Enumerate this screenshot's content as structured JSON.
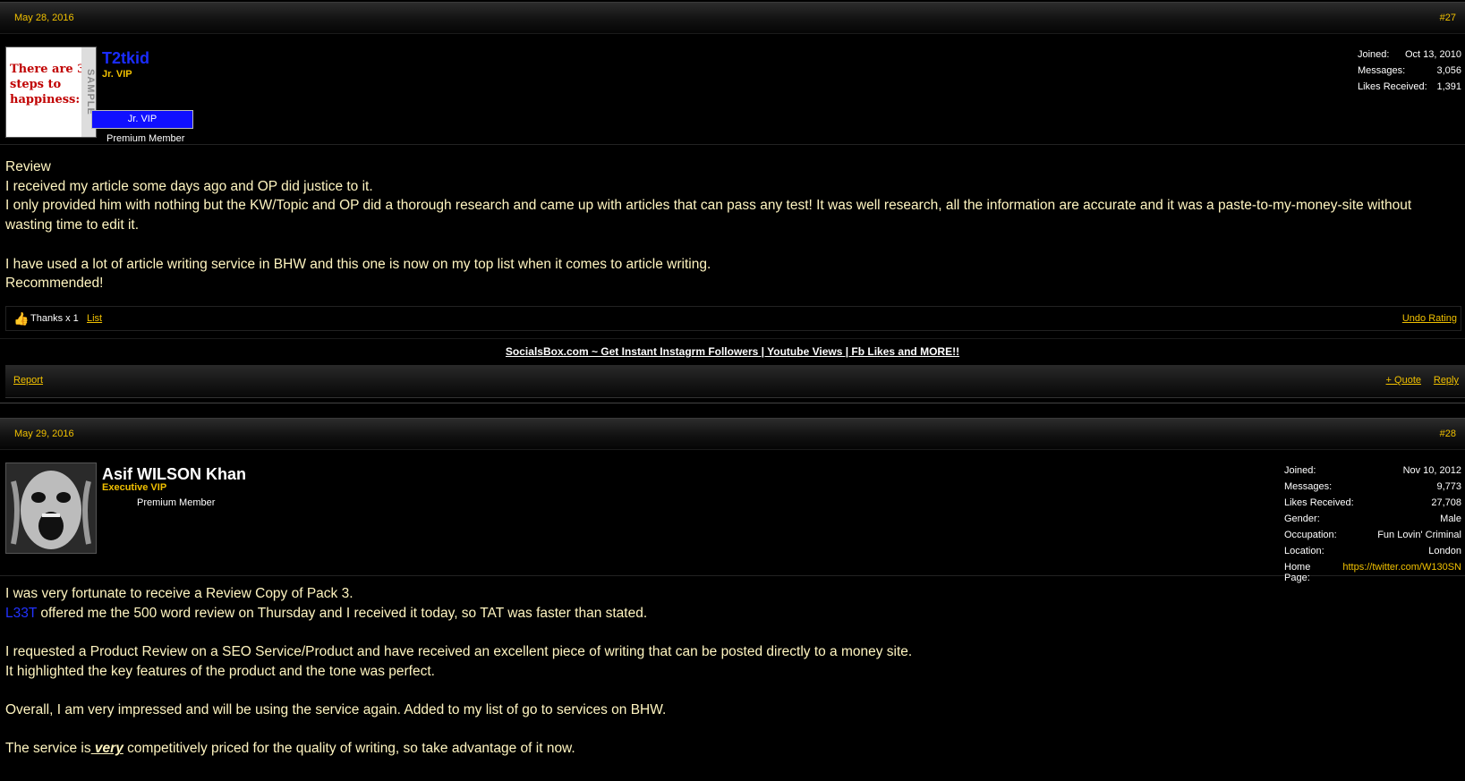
{
  "posts": [
    {
      "date": "May 28, 2016",
      "number": "#27",
      "avatar_text": "There are 3 steps to happiness:",
      "avatar_side_text": "SAMPLE",
      "username": "T2tkid",
      "usertitle": "Jr. VIP",
      "rank_banner": "Jr. VIP",
      "premium": "Premium Member",
      "extra": [
        {
          "label": "Joined:",
          "value": "Oct 13, 2010"
        },
        {
          "label": "Messages:",
          "value": "3,056"
        },
        {
          "label": "Likes Received:",
          "value": "1,391"
        }
      ],
      "content": [
        "Review",
        "I received my article some days ago and OP did justice to it.",
        "I only provided him with nothing but the KW/Topic and OP did a thorough research and came up with articles that can pass any test! It was well research, all the information are accurate and it was a paste-to-my-money-site without wasting time to edit it.",
        "",
        "I have used a lot of article writing service in BHW and this one is now on my top list when it comes to article writing.",
        "Recommended!"
      ],
      "ratings": {
        "thanks": "Thanks x 1",
        "list": "List",
        "undo": "Undo Rating"
      },
      "signature": "SocialsBox.com ~ Get Instant Instagrm Followers | Youtube Views | Fb Likes and MORE!!",
      "footer": {
        "report": "Report",
        "quote": "+ Quote",
        "reply": "Reply"
      }
    },
    {
      "date": "May 29, 2016",
      "number": "#28",
      "username": "Asif WILSON Khan",
      "usertitle": "Executive VIP",
      "premium": "Premium Member",
      "extra": [
        {
          "label": "Joined:",
          "value": "Nov 10, 2012"
        },
        {
          "label": "Messages:",
          "value": "9,773"
        },
        {
          "label": "Likes Received:",
          "value": "27,708"
        },
        {
          "label": "Gender:",
          "value": "Male"
        },
        {
          "label": "Occupation:",
          "value": "Fun Lovin' Criminal"
        },
        {
          "label": "Location:",
          "value": "London"
        },
        {
          "label": "Home Page:",
          "value": "https://twitter.com/W130SN"
        }
      ],
      "content": {
        "p1": "I was very fortunate to receive a Review Copy of Pack 3.",
        "p2_mention": "L33T",
        "p2_rest": " offered me the 500 word review on Thursday and I received it today, so TAT was faster than stated.",
        "p3": "I requested a Product Review on a SEO Service/Product and have received an excellent piece of writing that can be posted directly to a money site.",
        "p4": "It highlighted the key features of the product and the tone was perfect.",
        "p5": "Overall, I am very impressed and will be using the service again. Added to my list of go to services on BHW.",
        "p6_a": "The service is",
        "p6_em": " very",
        "p6_b": " competitively priced for the quality of writing, so take advantage of it now."
      }
    }
  ],
  "colors": {
    "accent": "#f0c000",
    "rank": "#1010ff",
    "mention": "#2233ff",
    "text": "#fff5c0"
  }
}
